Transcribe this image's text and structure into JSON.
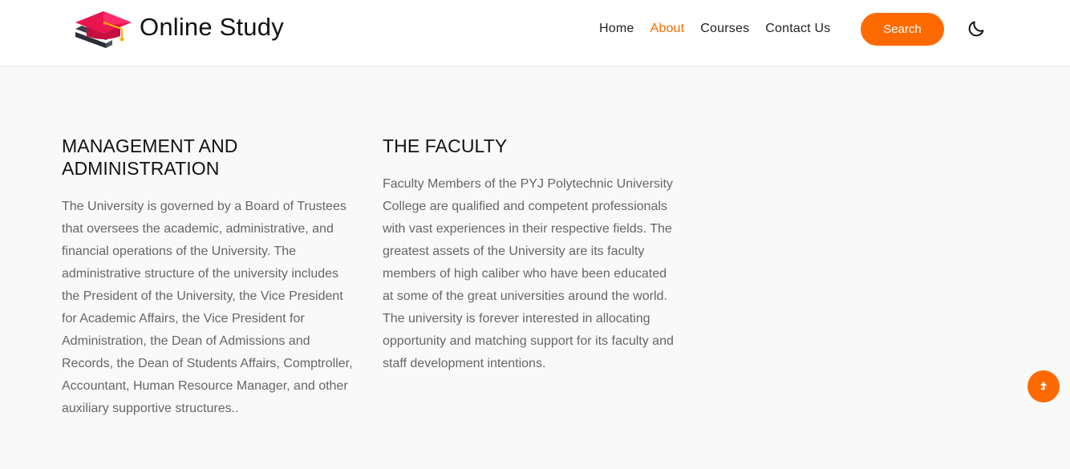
{
  "header": {
    "brand_name": "Online Study",
    "nav": [
      {
        "label": "Home",
        "active": false
      },
      {
        "label": "About",
        "active": true
      },
      {
        "label": "Courses",
        "active": false
      },
      {
        "label": "Contact Us",
        "active": false
      }
    ],
    "search_label": "Search",
    "theme_icon": "moon-icon",
    "logo_icon": "graduation-cap-icon"
  },
  "main": {
    "sections": [
      {
        "heading": "MANAGEMENT AND ADMINISTRATION",
        "body": "The University is governed by a Board of Trustees that oversees the academic, administrative, and financial operations of the University. The administrative structure of the university includes the President of the University, the Vice President for Academic Affairs, the Vice President for Administration, the Dean of Admissions and Records, the Dean of Students Affairs, Comptroller, Accountant, Human Resource Manager, and other auxiliary supportive structures.."
      },
      {
        "heading": "THE FACULTY",
        "body": "Faculty Members of the PYJ Polytechnic University College are qualified and competent professionals with vast experiences in their respective fields. The greatest assets of the University are its faculty members of high caliber who have been educated at some of the great universities around the world. The university is forever interested in allocating opportunity and matching support for its faculty and staff development intentions."
      }
    ]
  },
  "scroll_top_icon": "arrow-up-icon",
  "colors": {
    "accent": "#ff6a00",
    "page_bg": "#f9f9f9",
    "header_bg": "#ffffff",
    "logo_cap": "#e8154e",
    "logo_book": "#3b3f4a"
  }
}
